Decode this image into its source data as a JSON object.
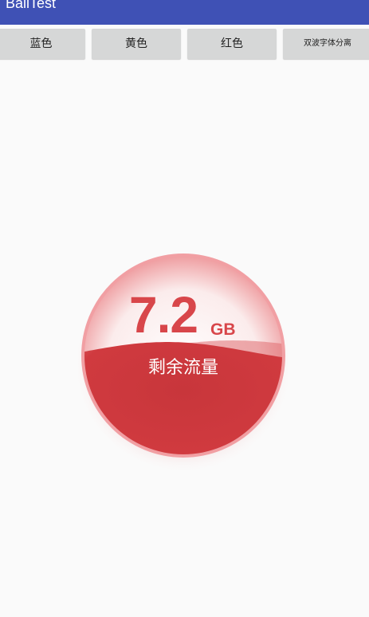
{
  "app_bar": {
    "title": "BallTest",
    "color": "#3f51b5"
  },
  "buttons": [
    {
      "label": "蓝色"
    },
    {
      "label": "黄色"
    },
    {
      "label": "红色"
    },
    {
      "label": "双波字体分离"
    }
  ],
  "ball": {
    "value": "7.2",
    "unit": "GB",
    "label": "剩余流量",
    "fill_level": 0.52,
    "wave_color": "#d03a3f",
    "text_color": "#d8464a"
  }
}
